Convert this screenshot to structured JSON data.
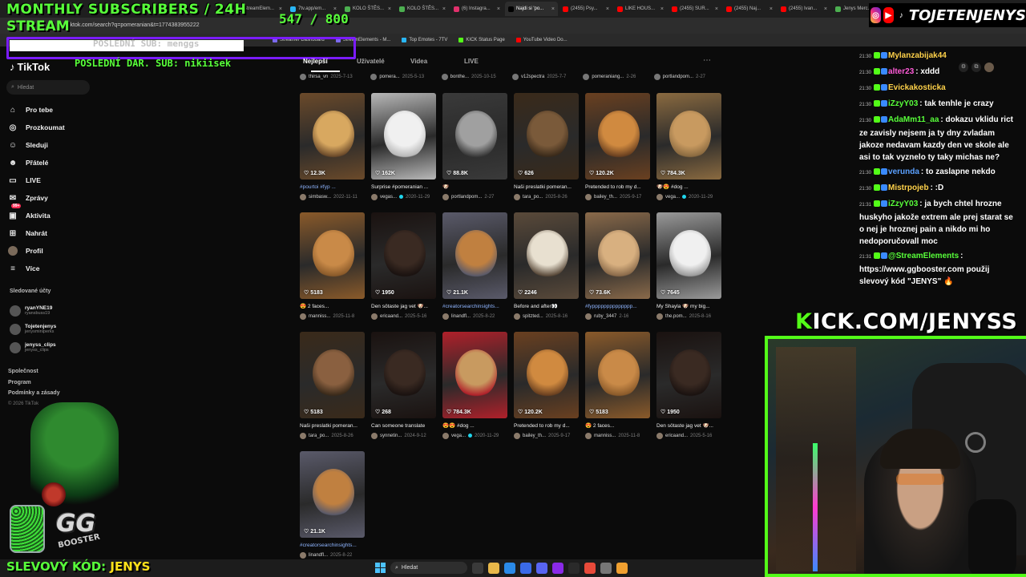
{
  "overlay": {
    "monthly_subs": "MONTHLY SUBSCRIBERS / 24H",
    "stream": "STREAM",
    "sub_count": "547 / 800",
    "last_sub": "POSLEDNÍ SUB: menggs",
    "last_dar": "POSLEDNÍ DAR. SUB: nikiisek",
    "discount_label": "SLEVOVÝ KÓD:",
    "discount_code": "JENYS",
    "social_name": "TOJETENJENYS",
    "kick": "KICK.COM/JENYSS",
    "gg_brand": "GG",
    "gg_sub": "BOOSTER"
  },
  "browser": {
    "address": "tiktok.com/search?q=pomeranian&t=1774383955222",
    "tabs": [
      {
        "label": "StreamElem...",
        "color": "#7b68ee",
        "active": false
      },
      {
        "label": "7tv.app/em...",
        "color": "#29b6f6",
        "active": false
      },
      {
        "label": "KOLO ŠTĚS...",
        "color": "#4caf50",
        "active": false
      },
      {
        "label": "KOLO ŠTĚS...",
        "color": "#4caf50",
        "active": false
      },
      {
        "label": "(6) Instagra...",
        "color": "#e1306c",
        "active": false
      },
      {
        "label": "Najdi si 'po...",
        "color": "#000000",
        "active": true
      },
      {
        "label": "(2455) Psy...",
        "color": "#ff0000",
        "active": false
      },
      {
        "label": "LIKE HOUS...",
        "color": "#ff0000",
        "active": false
      },
      {
        "label": "(2455) SUR...",
        "color": "#ff0000",
        "active": false
      },
      {
        "label": "(2455) Naj...",
        "color": "#ff0000",
        "active": false
      },
      {
        "label": "(2455) Ivan...",
        "color": "#ff0000",
        "active": false
      },
      {
        "label": "Jenys Merc...",
        "color": "#4caf50",
        "active": false
      }
    ],
    "bookmarks": [
      {
        "label": "Streamer Dashboard",
        "color": "#7b68ee"
      },
      {
        "label": "StreamElements - M...",
        "color": "#7b68ee"
      },
      {
        "label": "Top Emotes - 7TV",
        "color": "#29b6f6"
      },
      {
        "label": "KICK Status Page",
        "color": "#53fc18"
      },
      {
        "label": "YouTube Video Do...",
        "color": "#ff0000"
      }
    ]
  },
  "tiktok": {
    "logo": "TikTok",
    "search_placeholder": "Hledat",
    "nav": [
      {
        "label": "Pro tebe",
        "icon": "home-icon",
        "glyph": "⌂"
      },
      {
        "label": "Prozkoumat",
        "icon": "compass-icon",
        "glyph": "◎"
      },
      {
        "label": "Sleduji",
        "icon": "following-icon",
        "glyph": "☺"
      },
      {
        "label": "Přátelé",
        "icon": "friends-icon",
        "glyph": "☻"
      },
      {
        "label": "LIVE",
        "icon": "live-icon",
        "glyph": "▭"
      },
      {
        "label": "Zprávy",
        "icon": "messages-icon",
        "glyph": "✉"
      },
      {
        "label": "Aktivita",
        "icon": "activity-icon",
        "glyph": "▣"
      },
      {
        "label": "Nahrát",
        "icon": "upload-icon",
        "glyph": "⊞"
      },
      {
        "label": "Profil",
        "icon": "profile-icon",
        "glyph": ""
      },
      {
        "label": "Více",
        "icon": "more-icon",
        "glyph": "≡"
      }
    ],
    "messages_badge": "",
    "activity_badge": "99+",
    "following_title": "Sledované účty",
    "following": [
      {
        "name": "ryanYNE19",
        "handle": "ryansbuss19"
      },
      {
        "name": "Tojetenjenys",
        "handle": "jenysminiperks"
      },
      {
        "name": "jenyss_clips",
        "handle": "jenyss_clips"
      }
    ],
    "footer": [
      "Společnost",
      "Program",
      "Podmínky a zásady"
    ],
    "copyright": "© 2026 TikTok",
    "tabs": [
      "Nejlepší",
      "Uživatelé",
      "Videa",
      "LIVE"
    ],
    "top_row": [
      {
        "author": "thirsa_vn",
        "date": "2025-7-13"
      },
      {
        "author": "pomera...",
        "date": "2025-5-13"
      },
      {
        "author": "bonthe...",
        "date": "2025-10-15"
      },
      {
        "author": "v12spectra",
        "date": "2025-7-7"
      },
      {
        "author": "pomeraniang...",
        "date": "2-26"
      },
      {
        "author": "portlandpom...",
        "date": "2-27"
      }
    ],
    "videos": [
      {
        "likes": "12.3K",
        "caption": "#pourtoi #fyp ...",
        "tag": true,
        "author": "simbasw...",
        "date": "2022-11-11",
        "verified": false,
        "c1": "#d8a860",
        "c2": "#6b4a2a"
      },
      {
        "likes": "162K",
        "caption": "Surprise #pomeranian ...",
        "tag": false,
        "author": "vegas...",
        "date": "2020-11-29",
        "verified": true,
        "c1": "#f0f0f0",
        "c2": "#b8b8b8"
      },
      {
        "likes": "88.8K",
        "caption": "🐶",
        "tag": false,
        "author": "portlandpom...",
        "date": "2-27",
        "verified": false,
        "c1": "#a0a0a0",
        "c2": "#3a3a3a"
      },
      {
        "likes": "626",
        "caption": "Naši preslatki pomeran...",
        "tag": false,
        "author": "tara_po...",
        "date": "2025-8-26",
        "verified": false,
        "c1": "#7a5a3a",
        "c2": "#3a2a1a"
      },
      {
        "likes": "120.2K",
        "caption": "Pretended to rob my d...",
        "tag": false,
        "author": "bailey_th...",
        "date": "2025-9-17",
        "verified": false,
        "c1": "#d08a40",
        "c2": "#6a4020"
      },
      {
        "likes": "784.3K",
        "caption": "🐶😍 #dog ...",
        "tag": false,
        "author": "vega...",
        "date": "2020-11-29",
        "verified": true,
        "c1": "#c89a60",
        "c2": "#8a6a40"
      },
      {
        "likes": "5183",
        "caption": "😍 2 faces... ",
        "tag": false,
        "author": "manniss...",
        "date": "2025-11-8",
        "verified": false,
        "c1": "#c98a48",
        "c2": "#8a5a2a"
      },
      {
        "likes": "1950",
        "caption": "Den sötaste jag vet 🐶...",
        "tag": false,
        "author": "ericaand...",
        "date": "2025-5-16",
        "verified": false,
        "c1": "#3a2a22",
        "c2": "#1a1210"
      },
      {
        "likes": "21.1K",
        "caption": "#creatorsearchinsights...",
        "tag": true,
        "author": "linandfl...",
        "date": "2025-8-22",
        "verified": false,
        "c1": "#c08040",
        "c2": "#5a5a6a"
      },
      {
        "likes": "2246",
        "caption": "Before and after👀",
        "tag": false,
        "author": "spitzted...",
        "date": "2025-8-16",
        "verified": false,
        "c1": "#e8e0d0",
        "c2": "#5a4a3a"
      },
      {
        "likes": "73.6K",
        "caption": "#fypppppppppppppp...",
        "tag": true,
        "author": "ruby_3447",
        "date": "2-16",
        "verified": false,
        "c1": "#d8b080",
        "c2": "#8a6a4a"
      },
      {
        "likes": "7645",
        "caption": "My Shayla 🐶 my big...",
        "tag": false,
        "author": "the.pom...",
        "date": "2025-8-16",
        "verified": false,
        "c1": "#f0f0f0",
        "c2": "#9a9a9a"
      },
      {
        "likes": "5183",
        "caption": "Naši preslatki pomeran...",
        "tag": false,
        "author": "tara_po...",
        "date": "2025-8-26",
        "verified": false,
        "c1": "#8a6040",
        "c2": "#3a2a1a"
      },
      {
        "likes": "268",
        "caption": "Can someone translate",
        "tag": false,
        "author": "synnetin...",
        "date": "2024-9-12",
        "verified": false,
        "c1": "#3a2a22",
        "c2": "#1a1210"
      },
      {
        "likes": "784.3K",
        "caption": "😍😍 #dog ...",
        "tag": false,
        "author": "vega...",
        "date": "2020-11-29",
        "verified": true,
        "c1": "#c89a60",
        "c2": "#b0202a"
      },
      {
        "likes": "120.2K",
        "caption": "Pretended to rob my d...",
        "tag": false,
        "author": "bailey_th...",
        "date": "2025-9-17",
        "verified": false,
        "c1": "#d08a40",
        "c2": "#6a4020"
      },
      {
        "likes": "5183",
        "caption": "😍 2 faces... ",
        "tag": false,
        "author": "manniss...",
        "date": "2025-11-8",
        "verified": false,
        "c1": "#c98a48",
        "c2": "#8a5a2a"
      },
      {
        "likes": "1950",
        "caption": "Den sötaste jag vet 🐶...",
        "tag": false,
        "author": "ericaand...",
        "date": "2025-5-16",
        "verified": false,
        "c1": "#3a2a22",
        "c2": "#1a1210"
      },
      {
        "likes": "21.1K",
        "caption": "#creatorsearchinsights...",
        "tag": true,
        "author": "linandfl...",
        "date": "2025-8-22",
        "verified": false,
        "c1": "#c08040",
        "c2": "#5a5a6a"
      }
    ]
  },
  "chat": [
    {
      "time": "21:30",
      "user": "Mylanzabijak44",
      "color": "#ffd24a",
      "text": ""
    },
    {
      "time": "21:30",
      "user": "alter23",
      "color": "#ff5bd8",
      "text": ": xddd"
    },
    {
      "time": "21:30",
      "user": "Evickakosticka",
      "color": "#ffd24a",
      "text": ""
    },
    {
      "time": "21:30",
      "user": "iZzyY03",
      "color": "#58ff3a",
      "text": ": tak tenhle je crazy"
    },
    {
      "time": "21:30",
      "user": "AdaMm11_aa",
      "color": "#58ff3a",
      "text": ": dokazu vklidu rict ze zavisly nejsem ja ty dny zvladam jakoze nedavam kazdy den ve skole ale asi to tak vyznelo ty taky michas ne?"
    },
    {
      "time": "21:30",
      "user": "verunda",
      "color": "#5aa0ff",
      "text": ": to zaslapne nekdo"
    },
    {
      "time": "21:30",
      "user": "Mistrpojeb",
      "color": "#ffd24a",
      "text": ": :D"
    },
    {
      "time": "21:31",
      "user": "iZzyY03",
      "color": "#58ff3a",
      "text": ": ja bych chtel hrozne huskyho jakože extrem ale prej starat se o nej je hroznej pain a nikdo mi ho nedoporučovall moc"
    },
    {
      "time": "21:31",
      "user": "@StreamElements",
      "color": "#58ff3a",
      "text": ": https://www.ggbooster.com použij slevový kód \"JENYS\" 🔥"
    }
  ],
  "taskbar": {
    "search": "Hledat"
  }
}
